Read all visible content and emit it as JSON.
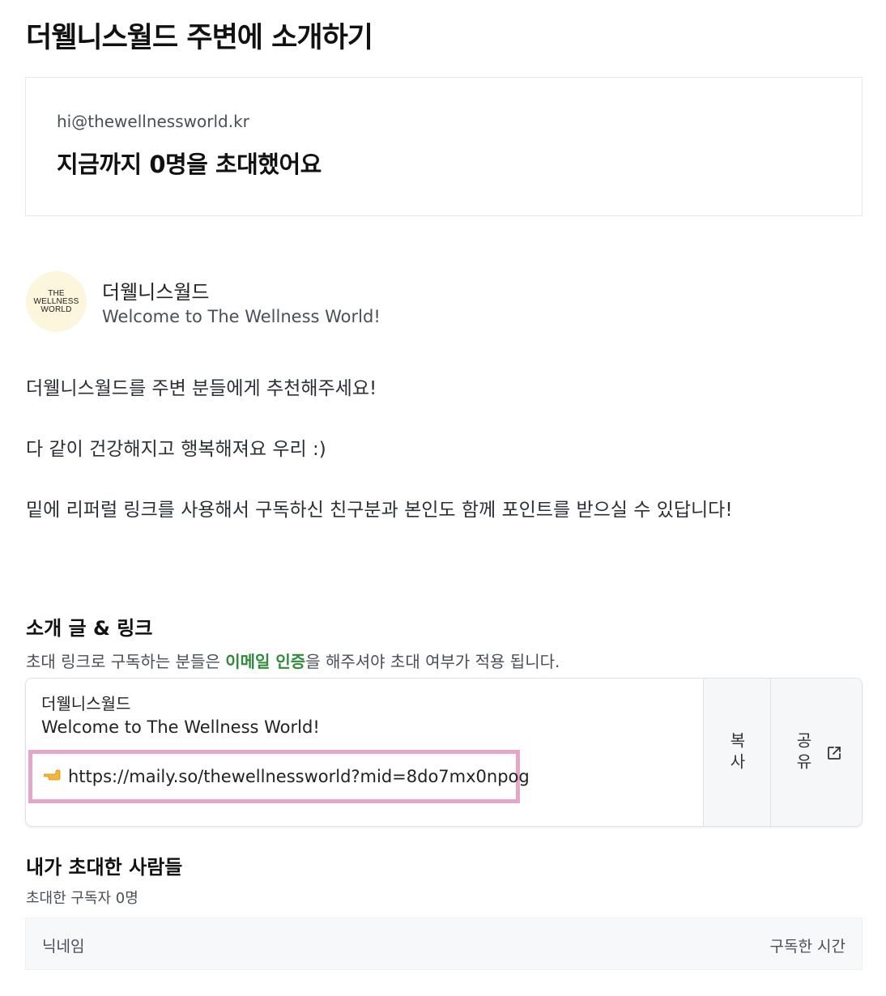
{
  "page": {
    "title": "더웰니스월드 주변에 소개하기"
  },
  "stats": {
    "email": "hi@thewellnessworld.kr",
    "invite_summary": "지금까지 0명을 초대했어요"
  },
  "profile": {
    "logo_lines": [
      "THE",
      "WELLNESS",
      "WORLD"
    ],
    "name": "더웰니스월드",
    "description": "Welcome to The Wellness World!"
  },
  "intro": {
    "line1": "더웰니스월드를 주변 분들에게 추천해주세요!",
    "line2": "다 같이 건강해지고 행복해져요 우리 :)",
    "line3": "밑에 리퍼럴 링크를 사용해서 구독하신 친구분과 본인도 함께 포인트를 받으실 수 있답니다!"
  },
  "share_section": {
    "title": "소개 글 & 링크",
    "notice_before": "초대 링크로 구독하는 분들은 ",
    "notice_highlight": "이메일 인증",
    "notice_after": "을 해주셔야 초대 여부가 적용 됩니다.",
    "box": {
      "name": "더웰니스월드",
      "description": "Welcome to The Wellness World!",
      "link_icon": "pointing-hand-icon",
      "link": "https://maily.so/thewellnessworld?mid=8do7mx0npog"
    },
    "copy_label": "복사",
    "share_label": "공유",
    "share_icon": "external-link-icon",
    "highlight_color": "#e6a6ca"
  },
  "invited": {
    "title": "내가 초대한 사람들",
    "count_text": "초대한 구독자 0명",
    "columns": [
      "닉네임",
      "구독한 시간"
    ]
  }
}
